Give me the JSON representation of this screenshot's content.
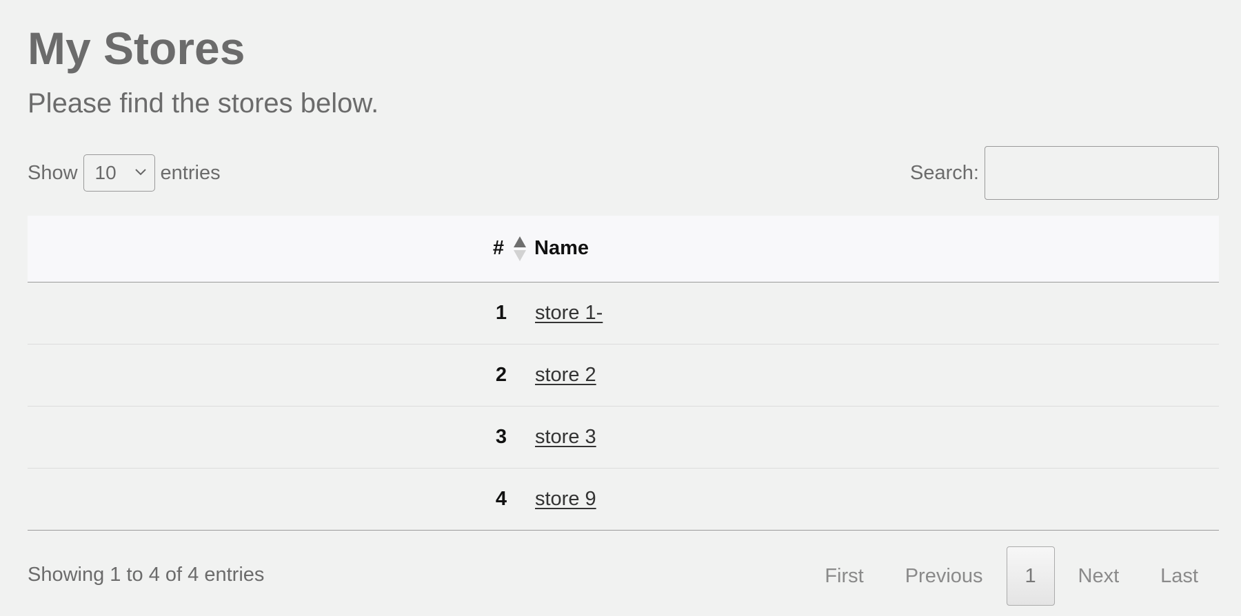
{
  "header": {
    "title": "My Stores",
    "subtitle": "Please find the stores below."
  },
  "length_control": {
    "show_label": "Show",
    "selected": "10",
    "entries_label": "entries"
  },
  "search": {
    "label": "Search:",
    "value": "",
    "placeholder": ""
  },
  "table": {
    "columns": [
      "#",
      "Name"
    ],
    "sort": {
      "column": "#",
      "direction": "ascending"
    },
    "rows": [
      {
        "num": "1",
        "name": "store 1-"
      },
      {
        "num": "2",
        "name": "store 2"
      },
      {
        "num": "3",
        "name": "store 3"
      },
      {
        "num": "4",
        "name": "store 9"
      }
    ]
  },
  "footer": {
    "info": "Showing 1 to 4 of 4 entries",
    "pagination": {
      "first": "First",
      "previous": "Previous",
      "current": "1",
      "next": "Next",
      "last": "Last"
    }
  },
  "icons": {
    "select_caret": "chevron-down-icon",
    "sort_indicator": "sort-ascending-icon"
  },
  "colors": {
    "background": "#f1f2f1",
    "header_row": "#f8f8fa",
    "text_muted": "#6b6b6b",
    "text_strong": "#111111"
  }
}
